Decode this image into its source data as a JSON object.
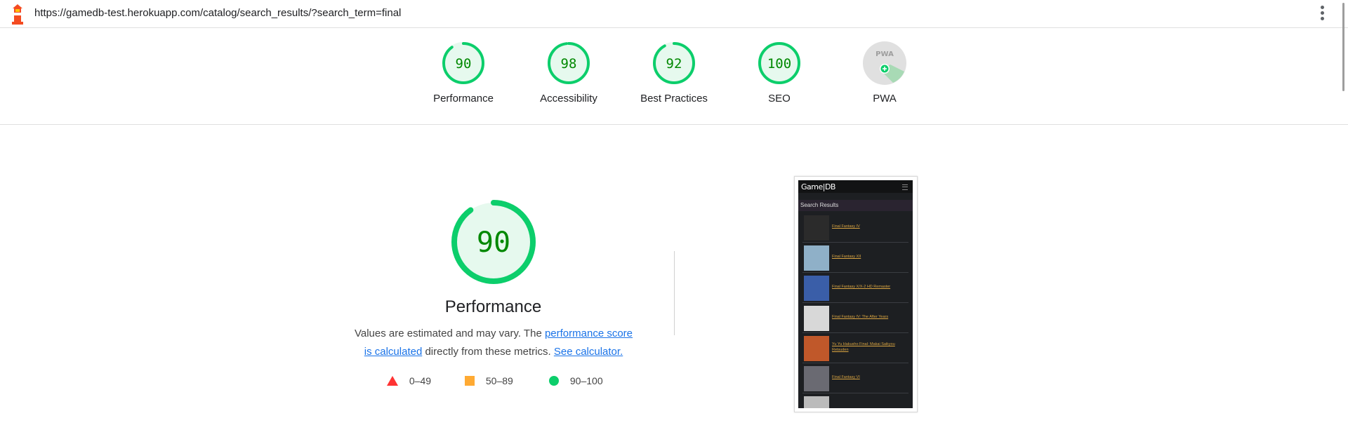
{
  "address_bar": {
    "url": "https://gamedb-test.herokuapp.com/catalog/search_results/?search_term=final"
  },
  "categories": [
    {
      "label": "Performance",
      "score": "90",
      "value": 90
    },
    {
      "label": "Accessibility",
      "score": "98",
      "value": 98
    },
    {
      "label": "Best Practices",
      "score": "92",
      "value": 92
    },
    {
      "label": "SEO",
      "score": "100",
      "value": 100
    },
    {
      "label": "PWA",
      "score": "",
      "badge_text": "PWA"
    }
  ],
  "performance": {
    "score": "90",
    "value": 90,
    "title": "Performance",
    "desc_prefix": "Values are estimated and may vary. The ",
    "desc_link1": "performance score is calculated",
    "desc_mid": " directly from these metrics. ",
    "desc_link2": "See calculator."
  },
  "legend": [
    {
      "range": "0–49",
      "color": "#ff3333",
      "shape": "triangle"
    },
    {
      "range": "50–89",
      "color": "#ffaa33",
      "shape": "square"
    },
    {
      "range": "90–100",
      "color": "#0cce6b",
      "shape": "circle"
    }
  ],
  "colors": {
    "pass": "#0cce6b",
    "pass_fill": "#e6f9ee",
    "pass_text": "#008800",
    "pwa_bg": "#e0e0e0"
  },
  "screenshot": {
    "logo": "Game|DB",
    "heading": "Search Results",
    "results": [
      {
        "title": "Final Fantasy IV",
        "thumb_color": "#2b2b2b"
      },
      {
        "title": "Final Fantasy XII",
        "thumb_color": "#8fb0c8"
      },
      {
        "title": "Final Fantasy X/X-2 HD Remaster",
        "thumb_color": "#3a5ea8"
      },
      {
        "title": "Final Fantasy IV: The After Years",
        "thumb_color": "#d8d8d8"
      },
      {
        "title": "Yu Yu Hakusho Final: Makai Saikyou Retsuden",
        "thumb_color": "#c0582a"
      },
      {
        "title": "Final Fantasy VI",
        "thumb_color": "#6a6a72"
      },
      {
        "title": "",
        "thumb_color": "#bbbbbb"
      }
    ]
  }
}
